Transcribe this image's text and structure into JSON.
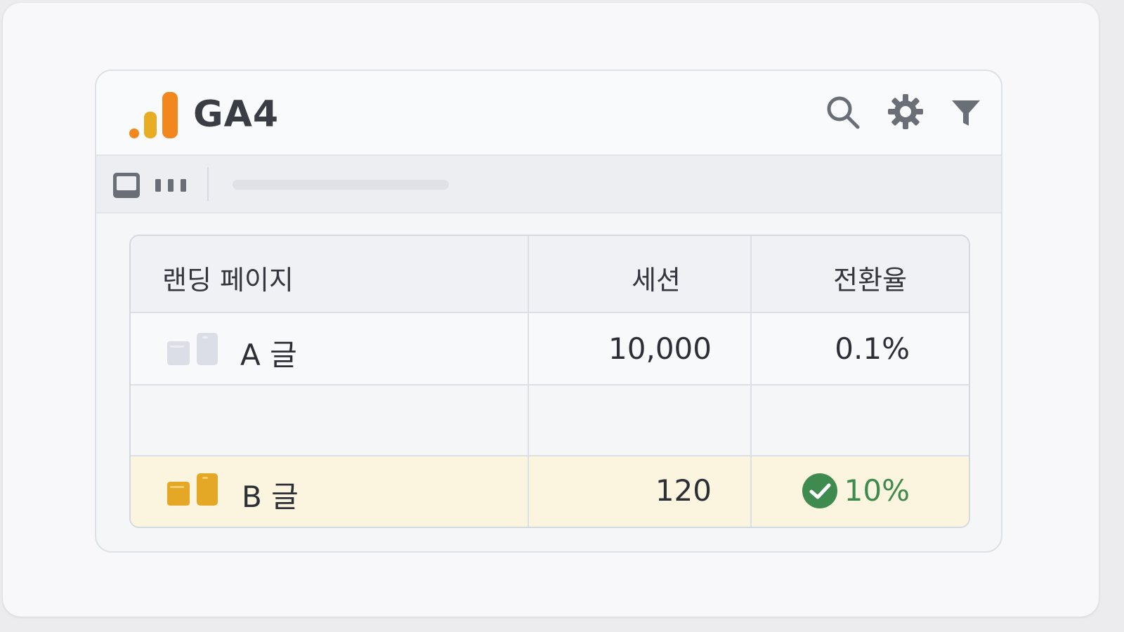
{
  "app": {
    "title": "GA4"
  },
  "header_icons": [
    "search-icon",
    "gear-icon",
    "filter-icon"
  ],
  "colors": {
    "accent_orange": "#f2871e",
    "accent_yellow": "#e8ad23",
    "highlight_row": "#fbf4de",
    "success_green": "#3f8a4e"
  },
  "table": {
    "columns": [
      "랜딩 페이지",
      "세션",
      "전환율"
    ],
    "rows": [
      {
        "page": "A 글",
        "sessions": "10,000",
        "conversion": "0.1%",
        "highlighted": false
      },
      {
        "page": "",
        "sessions": "",
        "conversion": "",
        "highlighted": false
      },
      {
        "page": "B 글",
        "sessions": "120",
        "conversion": "10%",
        "highlighted": true
      }
    ]
  }
}
